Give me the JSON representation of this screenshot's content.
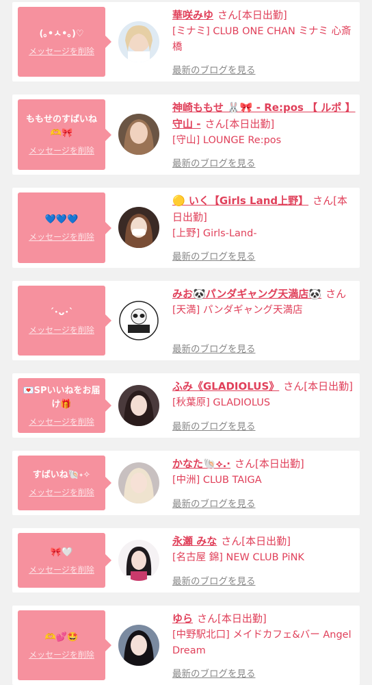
{
  "delete_label": "メッセージを削除",
  "blog_label": "最新のブログを見る",
  "san_label": "さん",
  "accent": "#f6919e",
  "text_pink": "#e0405a",
  "items": [
    {
      "message": "(｡•ㅅ•｡)♡",
      "name": "華咲みゆ",
      "status": "[本日出勤]",
      "shop": "[ミナミ] CLUB ONE CHAN ミナミ 心斎橋",
      "avatar": "avatar-blonde-woman"
    },
    {
      "message": "ももせのすばいね🫶🎀",
      "name": "神崎ももせ 🐰🎀 - Re:pos 【 ルポ 】守山 -",
      "status": "[本日出勤]",
      "shop": "[守山] LOUNGE Re:pos",
      "avatar": "avatar-brown-hair-woman"
    },
    {
      "message": "💙💙💙",
      "name": "🟡 いく【Girls Land上野】",
      "status": "[本日出勤]",
      "shop": "[上野] Girls-Land-",
      "avatar": "avatar-masked-woman"
    },
    {
      "message": "´･ᴗ･`",
      "name": "みお🐼パンダギャング天満店🐼",
      "status": "",
      "shop": "[天満] パンダギャング天満店",
      "avatar": "avatar-panda-logo"
    },
    {
      "message": "💌SPいいねをお届け🎁",
      "name": "ふみ《GLADIOLUS》",
      "status": "[本日出勤]",
      "shop": "[秋葉原] GLADIOLUS",
      "avatar": "avatar-dark-hair-woman"
    },
    {
      "message": "すばいね🐚˖✧",
      "name": "かなた🐚⟡.·",
      "status": "[本日出勤]",
      "shop": "[中洲] CLUB TAIGA",
      "avatar": "avatar-platinum-woman"
    },
    {
      "message": "🎀🤍",
      "name": "永瀬 みな",
      "status": "[本日出勤]",
      "shop": "[名古屋 錦] NEW CLUB PiNK",
      "avatar": "avatar-bob-hair-woman"
    },
    {
      "message": "🫶💕🤩",
      "name": "ゆら",
      "status": "[本日出勤]",
      "shop": "[中野駅北口] メイドカフェ&バー Angel Dream",
      "avatar": "avatar-black-hair-woman"
    }
  ]
}
